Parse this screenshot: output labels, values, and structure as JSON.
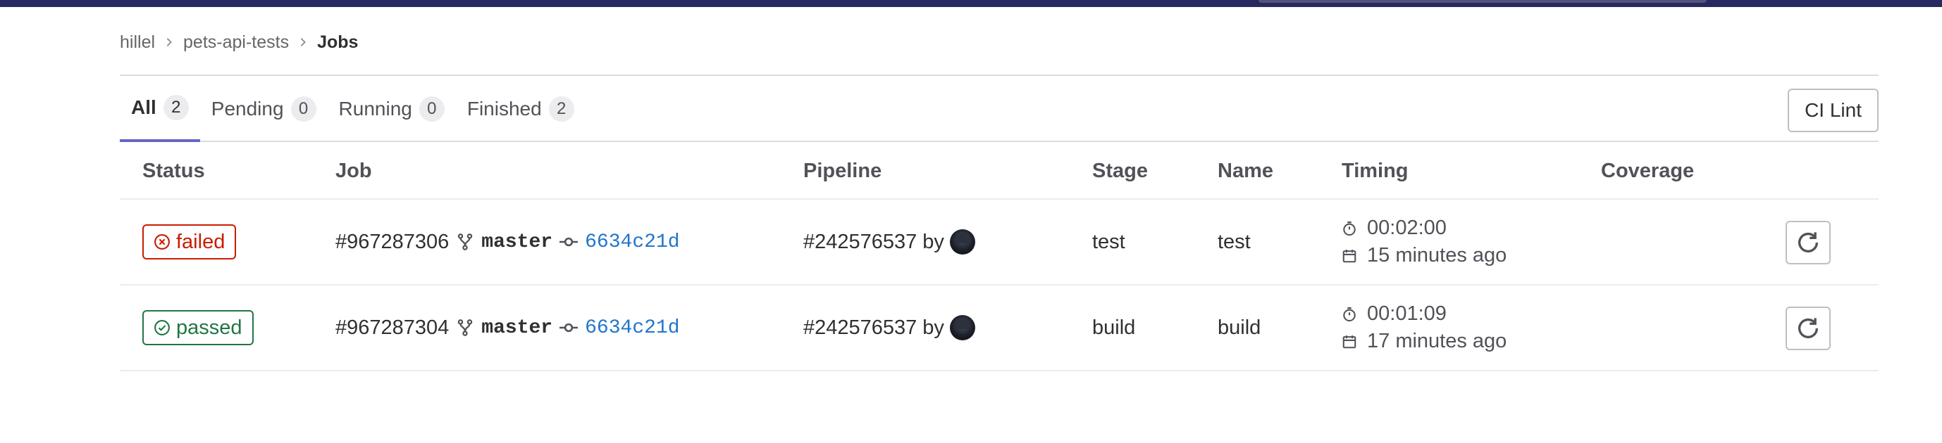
{
  "breadcrumb": [
    "hillel",
    "pets-api-tests",
    "Jobs"
  ],
  "tabs": [
    {
      "label": "All",
      "count": "2"
    },
    {
      "label": "Pending",
      "count": "0"
    },
    {
      "label": "Running",
      "count": "0"
    },
    {
      "label": "Finished",
      "count": "2"
    }
  ],
  "ci_lint_label": "CI Lint",
  "columns": {
    "status": "Status",
    "job": "Job",
    "pipeline": "Pipeline",
    "stage": "Stage",
    "name": "Name",
    "timing": "Timing",
    "coverage": "Coverage"
  },
  "jobs": [
    {
      "status": "failed",
      "job_id": "#967287306",
      "ref": "master",
      "sha": "6634c21d",
      "pipeline_id": "#242576537",
      "by": "by",
      "stage": "test",
      "name": "test",
      "duration": "00:02:00",
      "finished": "15 minutes ago"
    },
    {
      "status": "passed",
      "job_id": "#967287304",
      "ref": "master",
      "sha": "6634c21d",
      "pipeline_id": "#242576537",
      "by": "by",
      "stage": "build",
      "name": "build",
      "duration": "00:01:09",
      "finished": "17 minutes ago"
    }
  ],
  "icons": {
    "breadcrumb_separator": "chevron-right-icon",
    "status_failed": "status-failed-icon",
    "status_passed": "status-success-icon",
    "branch": "branch-icon",
    "commit": "commit-icon",
    "duration": "timer-icon",
    "finished": "calendar-icon",
    "retry": "retry-icon",
    "avatar": "user-avatar"
  },
  "colors": {
    "topbar": "#292961",
    "active_tab_underline": "#6666c4",
    "failed": "#c91c00",
    "passed": "#217645",
    "link": "#1f75cb"
  }
}
